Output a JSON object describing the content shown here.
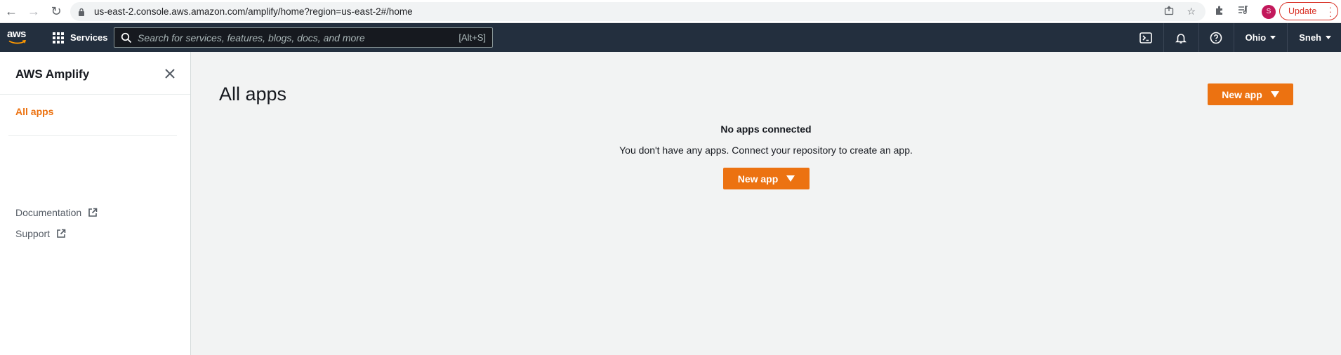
{
  "browser": {
    "url": "us-east-2.console.aws.amazon.com/amplify/home?region=us-east-2#/home",
    "profile_initial": "S",
    "update_label": "Update"
  },
  "aws_nav": {
    "logo_text": "aws",
    "services_label": "Services",
    "search_placeholder": "Search for services, features, blogs, docs, and more",
    "search_shortcut": "[Alt+S]",
    "region_label": "Ohio",
    "user_label": "Sneh"
  },
  "sidebar": {
    "title": "AWS Amplify",
    "items": [
      {
        "label": "All apps",
        "active": true
      },
      {
        "label": "Documentation",
        "external": true
      },
      {
        "label": "Support",
        "external": true
      }
    ]
  },
  "main": {
    "page_title": "All apps",
    "new_app_label": "New app",
    "empty_title": "No apps connected",
    "empty_description": "You don't have any apps. Connect your repository to create an app."
  },
  "colors": {
    "aws_nav_bg": "#232f3e",
    "accent_orange": "#ec7211",
    "page_bg": "#f2f3f3"
  }
}
